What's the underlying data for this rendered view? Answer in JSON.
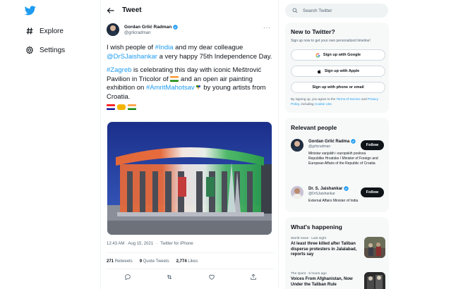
{
  "nav": {
    "explore_label": "Explore",
    "settings_label": "Settings"
  },
  "header": {
    "title": "Tweet"
  },
  "tweet": {
    "author_name": "Gordan Grlić Radman",
    "author_handle": "@grlicradman",
    "more_label": "···",
    "line1_prefix": "I wish people of ",
    "line1_link": "#India",
    "line1_mid": " and my dear colleague ",
    "line1_mention": "@DrSJaishankar",
    "line1_suffix": " a very happy 75th Independence Day.",
    "line2_hashtag": "#Zagreb",
    "line2_text_a": " is celebrating this day with iconic Meštrović Pavilion in Tricolor of ",
    "line2_text_b": " and an open air painting exhibition on ",
    "line2_hashtag2": "#AmritMahotsav",
    "line2_text_c": " by young artists from Croatia.",
    "timestamp": "12:43 AM · Aug 15, 2021",
    "separator": "·",
    "source": "Twitter for iPhone",
    "retweets_count": "271",
    "retweets_label": "Retweets",
    "quotes_count": "9",
    "quotes_label": "Quote Tweets",
    "likes_count": "2,774",
    "likes_label": "Likes"
  },
  "search": {
    "placeholder": "Search Twitter"
  },
  "signup": {
    "title": "New to Twitter?",
    "subtitle": "Sign up now to get your own personalized timeline!",
    "google_label": "Sign up with Google",
    "apple_label": "Sign up with Apple",
    "email_label": "Sign up with phone or email",
    "terms_prefix": "By signing up, you agree to the ",
    "terms_link": "Terms of Service",
    "terms_mid": " and ",
    "privacy_link": "Privacy Policy",
    "terms_mid2": ", including ",
    "cookie_link": "Cookie Use",
    "terms_end": "."
  },
  "relevant": {
    "title": "Relevant people",
    "people": [
      {
        "name": "Gordan Grlić Radma",
        "handle": "@grlicradman",
        "bio": "Ministar vanjskih i europskih poslova Republike Hrvatske / Minister of Foreign and European Affairs of the Republic of Croatia",
        "follow_label": "Follow"
      },
      {
        "name": "Dr. S. Jaishankar",
        "handle": "@DrSJaishankar",
        "bio": "External Affairs Minister of India",
        "follow_label": "Follow"
      }
    ]
  },
  "happening": {
    "title": "What's happening",
    "items": [
      {
        "category": "World news · Last night",
        "title": "At least three killed after Taliban disperse protesters in Jalalabad, reports say"
      },
      {
        "category": "The Quint · 5 hours ago",
        "title": "Voices From Afghanistan, Now Under the Taliban Rule"
      }
    ]
  },
  "colors": {
    "accent": "#1d9bf0",
    "text": "#0f1419",
    "muted": "#536471",
    "card_bg": "#f7f9f9"
  }
}
